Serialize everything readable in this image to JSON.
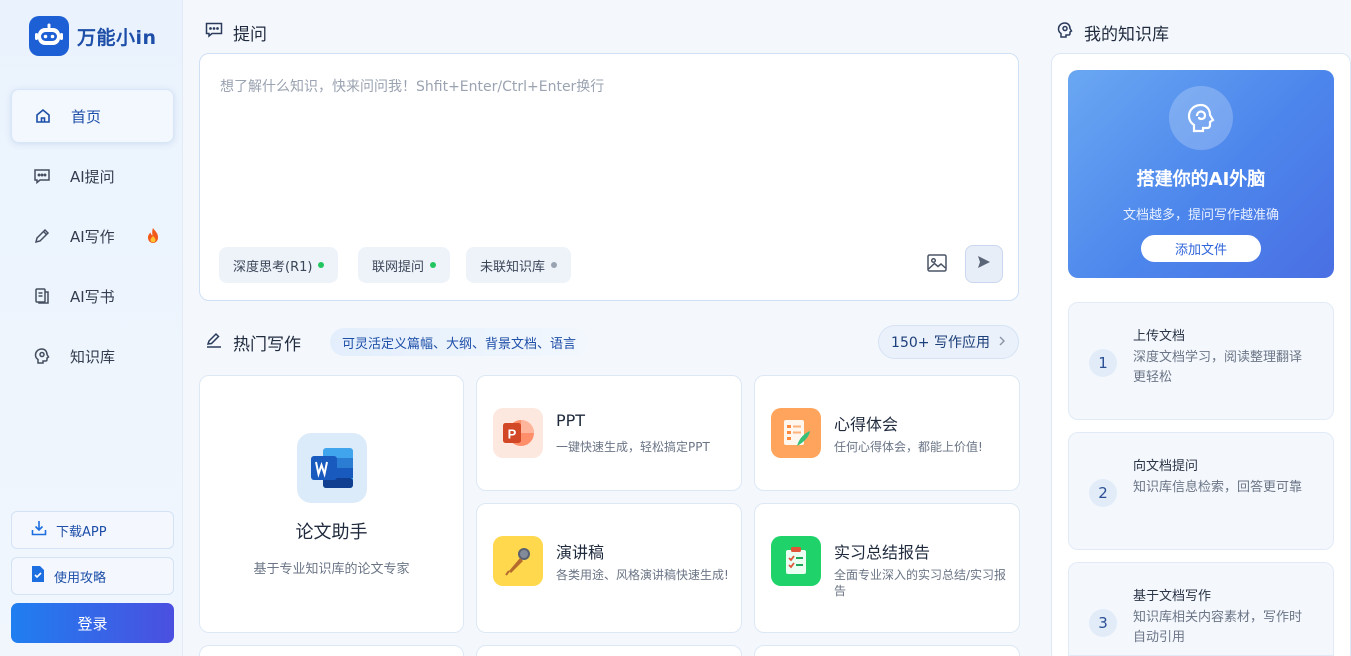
{
  "app": {
    "name": "万能小in"
  },
  "sidebar": {
    "items": [
      {
        "label": "首页",
        "icon": "home-icon",
        "active": true
      },
      {
        "label": "AI提问",
        "icon": "chat-icon"
      },
      {
        "label": "AI写作",
        "icon": "pencil-icon",
        "badge": "fire-icon"
      },
      {
        "label": "AI写书",
        "icon": "book-icon"
      },
      {
        "label": "知识库",
        "icon": "brain-icon"
      }
    ],
    "download_app": "下载APP",
    "guide": "使用攻略",
    "login": "登录"
  },
  "ask": {
    "title": "提问",
    "placeholder": "想了解什么知识，快来问问我！Shfit+Enter/Ctrl+Enter换行",
    "chips": [
      {
        "label": "深度思考(R1)",
        "dot_color": "#22c55e"
      },
      {
        "label": "联网提问",
        "dot_color": "#22c55e"
      },
      {
        "label": "未联知识库",
        "dot_color": "#9aa3b1"
      }
    ]
  },
  "hot_writing": {
    "title": "热门写作",
    "subtitle": "可灵活定义篇幅、大纲、背景文档、语言",
    "more": "150+ 写作应用",
    "featured": {
      "title": "论文助手",
      "desc": "基于专业知识库的论文专家"
    },
    "cards": [
      {
        "title": "PPT",
        "desc": "一键快速生成，轻松搞定PPT",
        "icon": "ppt-icon"
      },
      {
        "title": "心得体会",
        "desc": "任何心得体会，都能上价值!",
        "icon": "notebook-icon"
      },
      {
        "title": "演讲稿",
        "desc": "各类用途、风格演讲稿快速生成!",
        "icon": "microphone-icon"
      },
      {
        "title": "实习总结报告",
        "desc": "全面专业深入的实习总结/实习报告",
        "icon": "clipboard-icon"
      }
    ]
  },
  "knowledge": {
    "title": "我的知识库",
    "hero": {
      "title": "搭建你的AI外脑",
      "desc": "文档越多，提问写作越准确",
      "button": "添加文件"
    },
    "steps": [
      {
        "num": "1",
        "title": "上传文档",
        "desc": "深度文档学习，阅读整理翻译更轻松"
      },
      {
        "num": "2",
        "title": "向文档提问",
        "desc": "知识库信息检索，回答更可靠"
      },
      {
        "num": "3",
        "title": "基于文档写作",
        "desc": "知识库相关内容素材，写作时自动引用"
      }
    ]
  },
  "colors": {
    "brand": "#1d5fd4",
    "login_start": "#1f7ff0",
    "login_end": "#4b4fe0"
  }
}
